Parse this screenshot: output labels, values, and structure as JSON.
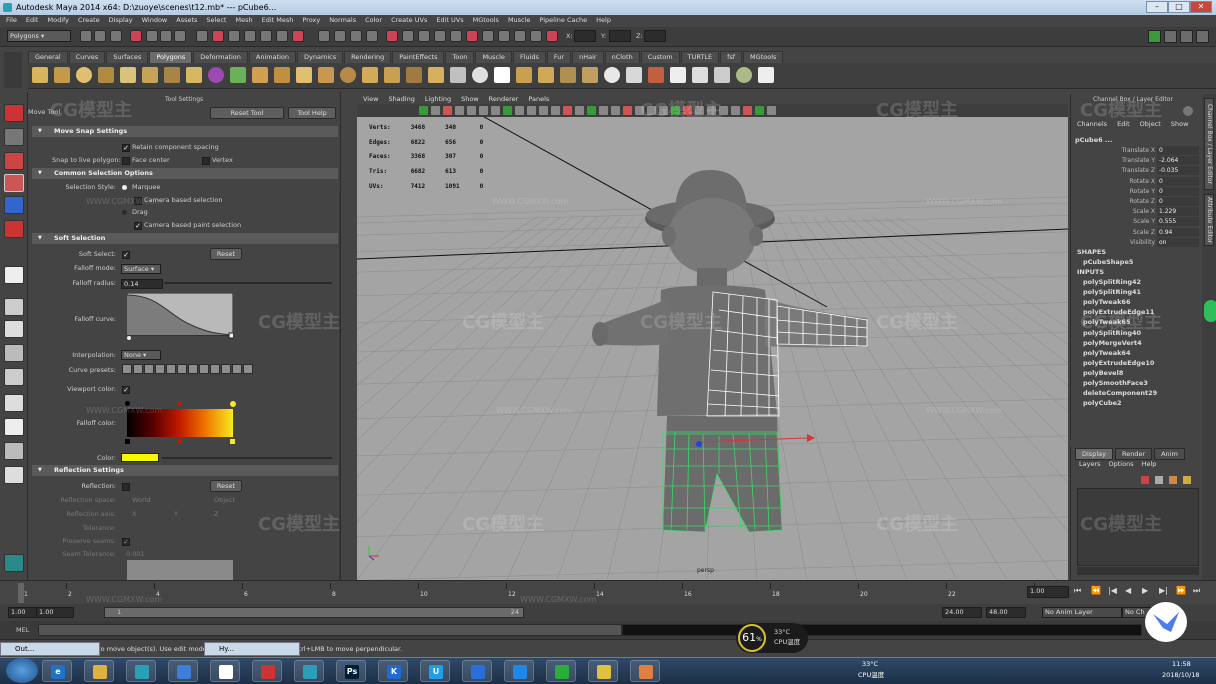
{
  "window": {
    "title": "Autodesk Maya 2014 x64: D:\\zuoye\\scenes\\t12.mb*   ---   pCube6..."
  },
  "menu": [
    "File",
    "Edit",
    "Modify",
    "Create",
    "Display",
    "Window",
    "Assets",
    "Select",
    "Mesh",
    "Edit Mesh",
    "Proxy",
    "Normals",
    "Color",
    "Create UVs",
    "Edit UVs",
    "MGtools",
    "Muscle",
    "Pipeline Cache",
    "Help"
  ],
  "status_line": {
    "mode": "Polygons",
    "x_label": "X:",
    "y_label": "Y:",
    "z_label": "Z:"
  },
  "shelf_tabs": [
    "General",
    "Curves",
    "Surfaces",
    "Polygons",
    "Deformation",
    "Animation",
    "Dynamics",
    "Rendering",
    "PaintEffects",
    "Toon",
    "Muscle",
    "Fluids",
    "Fur",
    "nHair",
    "nCloth",
    "Custom",
    "TURTLE",
    "fsf",
    "MGtools"
  ],
  "shelf_active": "Polygons",
  "tool_settings": {
    "panel_label": "Tool Settings",
    "tool_name": "Move Tool",
    "reset_tool": "Reset Tool",
    "tool_help": "Tool Help",
    "move_snap": {
      "header": "Move Snap Settings",
      "retain": "Retain component spacing",
      "snap_label": "Snap to live polygon:",
      "face_center": "Face center",
      "vertex": "Vertex"
    },
    "common": {
      "header": "Common Selection Options",
      "style_label": "Selection Style:",
      "marquee": "Marquee",
      "camera_based": "Camera based selection",
      "drag": "Drag",
      "camera_paint": "Camera based paint selection"
    },
    "soft": {
      "header": "Soft Selection",
      "soft_select": "Soft Select:",
      "reset": "Reset",
      "falloff_mode_label": "Falloff mode:",
      "falloff_mode": "Surface",
      "falloff_radius_label": "Falloff radius:",
      "falloff_radius": "0.14",
      "falloff_curve": "Falloff curve:",
      "interp_label": "Interpolation:",
      "interp": "None",
      "presets": "Curve presets:",
      "viewport_color": "Viewport color:",
      "falloff_color": "Falloff color:",
      "color_label": "Color:"
    },
    "reflection": {
      "header": "Reflection Settings",
      "reflection": "Reflection:",
      "reset": "Reset",
      "space_label": "Reflection space:",
      "world": "World",
      "object": "Object",
      "axis_label": "Reflection axis:",
      "x": "X",
      "y": "Y",
      "z": "Z",
      "tolerance": "Tolerance:",
      "preserve": "Preserve seams:",
      "seam_tol": "Seam Tolerance:",
      "seam_tol_val": "0.001"
    }
  },
  "viewport": {
    "menu": [
      "View",
      "Shading",
      "Lighting",
      "Show",
      "Renderer",
      "Panels"
    ],
    "hud_labels": [
      "Verts:",
      "Edges:",
      "Faces:",
      "Tris:",
      "UVs:"
    ],
    "hud_values": [
      [
        "3468",
        "340",
        "0"
      ],
      [
        "6822",
        "656",
        "0"
      ],
      [
        "3368",
        "307",
        "0"
      ],
      [
        "6682",
        "613",
        "0"
      ],
      [
        "7412",
        "1091",
        "0"
      ]
    ],
    "camera": "persp"
  },
  "channel_box": {
    "title": "Channel Box / Layer Editor",
    "menu": [
      "Channels",
      "Edit",
      "Object",
      "Show"
    ],
    "object": "pCube6 ...",
    "channels": [
      [
        "Translate X",
        "0"
      ],
      [
        "Translate Y",
        "-2.064"
      ],
      [
        "Translate Z",
        "-0.035"
      ],
      [
        "Rotate X",
        "0"
      ],
      [
        "Rotate Y",
        "0"
      ],
      [
        "Rotate Z",
        "0"
      ],
      [
        "Scale X",
        "1.229"
      ],
      [
        "Scale Y",
        "0.555"
      ],
      [
        "Scale Z",
        "0.94"
      ],
      [
        "Visibility",
        "on"
      ]
    ],
    "shapes_label": "SHAPES",
    "shape": "pCubeShape5",
    "inputs_label": "INPUTS",
    "inputs": [
      "polySplitRing42",
      "polySplitRing41",
      "polyTweak66",
      "polyExtrudeEdge11",
      "polyTweak65",
      "polySplitRing40",
      "polyMergeVert4",
      "polyTweak64",
      "polyExtrudeEdge10",
      "polyBevel8",
      "polySmoothFace3",
      "deleteComponent29",
      "polyCube2"
    ]
  },
  "layer_editor": {
    "tabs": [
      "Display",
      "Render",
      "Anim"
    ],
    "menu": [
      "Layers",
      "Options",
      "Help"
    ]
  },
  "side_tabs": [
    "Channel Box / Layer Editor",
    "Attribute Editor"
  ],
  "time_slider": {
    "ticks": [
      "1",
      "2",
      "4",
      "6",
      "8",
      "10",
      "12",
      "14",
      "16",
      "18",
      "20",
      "22",
      "24"
    ],
    "current": "1.00"
  },
  "range": {
    "start": "1.00",
    "start2": "1.00",
    "range_start_marker": "1",
    "range_end_marker": "24",
    "end": "24.00",
    "end2": "48.00",
    "anim_layer": "No Anim Layer",
    "char_set": "No Ch"
  },
  "command": {
    "label": "MEL"
  },
  "help_line": {
    "text": "Move Tool: Use manipulator to move object(s). Use edit mode to change pivot (INSERT). Ctrl+LMB to move perpendicular."
  },
  "cpu": {
    "percent": "61",
    "unit": "%",
    "temp": "33°C",
    "label": "CPU温度"
  },
  "taskbar": {
    "win1": "Out...",
    "win2": "Hy...",
    "weather_temp": "33°C",
    "weather_label": "CPU温度",
    "time": "11:58",
    "date": "2018/10/18"
  },
  "watermarks": {
    "logo": "CG模型主",
    "url": "WWW.CGMXW.com"
  }
}
